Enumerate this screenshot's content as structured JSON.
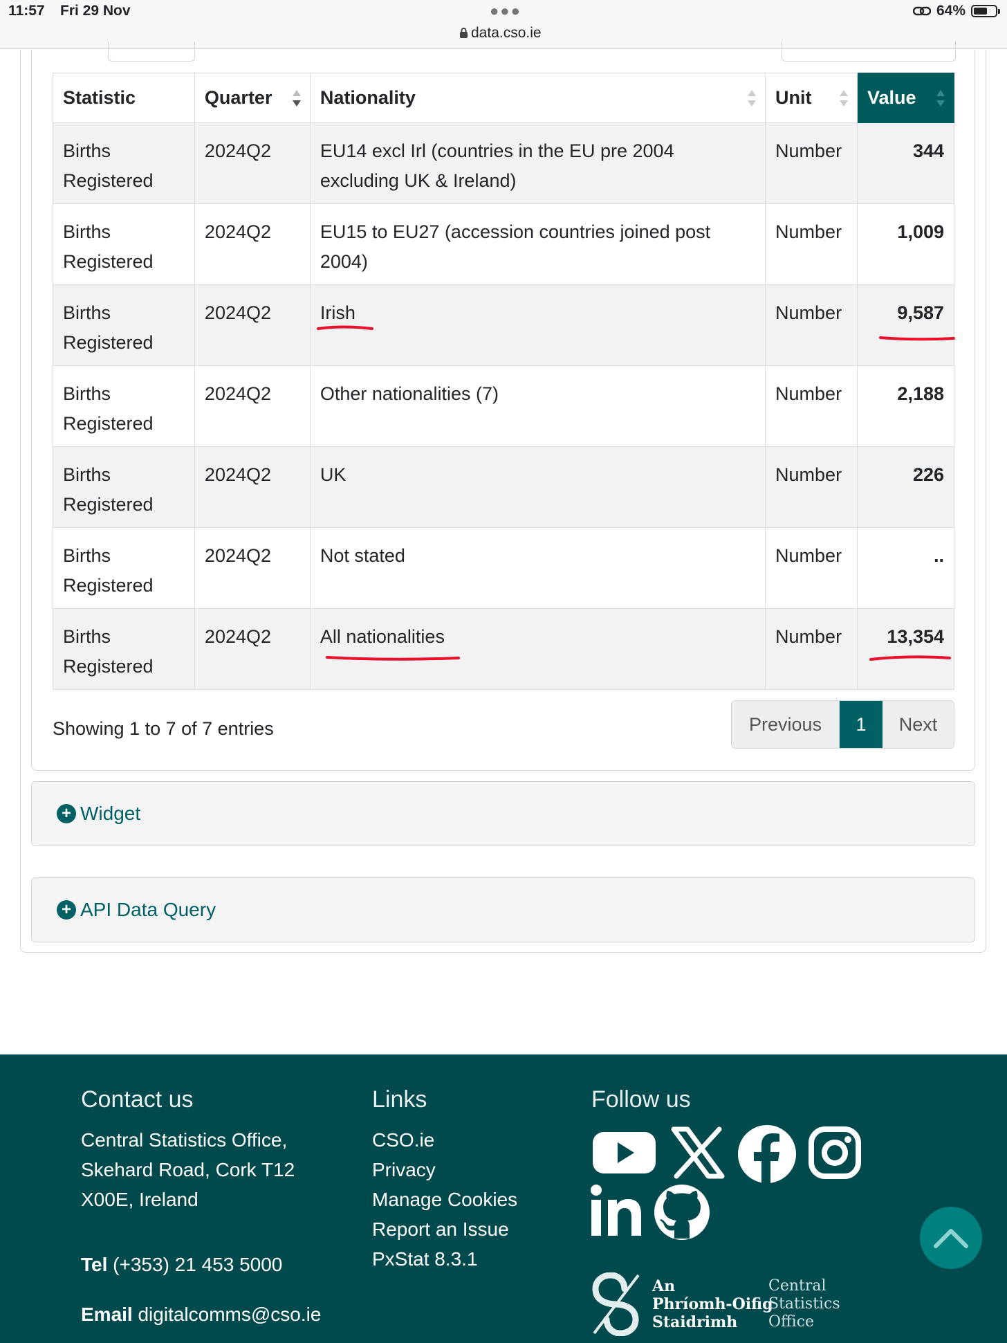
{
  "status_bar": {
    "time": "11:57",
    "date": "Fri 29 Nov",
    "url": "data.cso.ie",
    "battery": "64%",
    "battery_level": 0.64
  },
  "table": {
    "columns": [
      "Statistic",
      "Quarter",
      "Nationality",
      "Unit",
      "Value"
    ],
    "sorted_column": "Value",
    "rows": [
      {
        "statistic": "Births Registered",
        "quarter": "2024Q2",
        "nationality": "EU14 excl Irl (countries in the EU pre 2004 excluding UK & Ireland)",
        "unit": "Number",
        "value": "344"
      },
      {
        "statistic": "Births Registered",
        "quarter": "2024Q2",
        "nationality": "EU15 to EU27 (accession countries joined post 2004)",
        "unit": "Number",
        "value": "1,009"
      },
      {
        "statistic": "Births Registered",
        "quarter": "2024Q2",
        "nationality": "Irish",
        "unit": "Number",
        "value": "9,587"
      },
      {
        "statistic": "Births Registered",
        "quarter": "2024Q2",
        "nationality": "Other nationalities (7)",
        "unit": "Number",
        "value": "2,188"
      },
      {
        "statistic": "Births Registered",
        "quarter": "2024Q2",
        "nationality": "UK",
        "unit": "Number",
        "value": "226"
      },
      {
        "statistic": "Births Registered",
        "quarter": "2024Q2",
        "nationality": "Not stated",
        "unit": "Number",
        "value": ".."
      },
      {
        "statistic": "Births Registered",
        "quarter": "2024Q2",
        "nationality": "All nationalities",
        "unit": "Number",
        "value": "13,354"
      }
    ]
  },
  "table_info": "Showing 1 to 7 of 7 entries",
  "pagination": {
    "previous": "Previous",
    "current": "1",
    "next": "Next"
  },
  "accordions": [
    "Widget",
    "API Data Query"
  ],
  "footer": {
    "contact": {
      "heading": "Contact us",
      "address": [
        "Central Statistics Office,",
        "Skehard Road, Cork T12",
        "X00E, Ireland"
      ],
      "tel_label": "Tel",
      "tel": "(+353) 21 453 5000",
      "email_label": "Email",
      "email": "digitalcomms@cso.ie"
    },
    "links": {
      "heading": "Links",
      "items": [
        "CSO.ie",
        "Privacy",
        "Manage Cookies",
        "Report an Issue",
        "PxStat 8.3.1"
      ]
    },
    "follow": {
      "heading": "Follow us",
      "icons": [
        "youtube-icon",
        "x-icon",
        "facebook-icon",
        "instagram-icon",
        "linkedin-icon",
        "github-icon"
      ]
    },
    "logo": {
      "irish": [
        "An",
        "Phríomh-Oifig",
        "Staidrimh"
      ],
      "english": [
        "Central",
        "Statistics",
        "Office"
      ]
    }
  },
  "colors": {
    "accent": "#00595a",
    "footer_bg": "#00494c",
    "annotation": "#e8102b"
  }
}
